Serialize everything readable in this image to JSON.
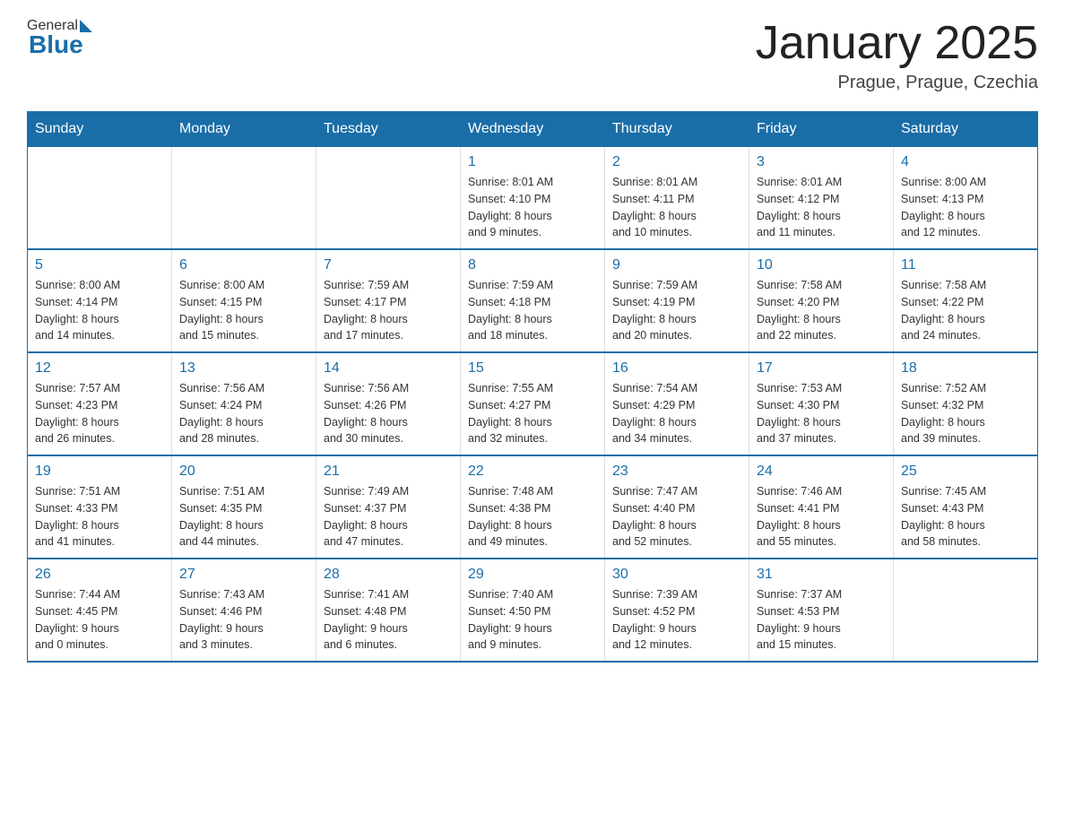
{
  "header": {
    "logo_general": "General",
    "logo_blue": "Blue",
    "title": "January 2025",
    "subtitle": "Prague, Prague, Czechia"
  },
  "days_of_week": [
    "Sunday",
    "Monday",
    "Tuesday",
    "Wednesday",
    "Thursday",
    "Friday",
    "Saturday"
  ],
  "weeks": [
    [
      {
        "day": "",
        "info": ""
      },
      {
        "day": "",
        "info": ""
      },
      {
        "day": "",
        "info": ""
      },
      {
        "day": "1",
        "info": "Sunrise: 8:01 AM\nSunset: 4:10 PM\nDaylight: 8 hours\nand 9 minutes."
      },
      {
        "day": "2",
        "info": "Sunrise: 8:01 AM\nSunset: 4:11 PM\nDaylight: 8 hours\nand 10 minutes."
      },
      {
        "day": "3",
        "info": "Sunrise: 8:01 AM\nSunset: 4:12 PM\nDaylight: 8 hours\nand 11 minutes."
      },
      {
        "day": "4",
        "info": "Sunrise: 8:00 AM\nSunset: 4:13 PM\nDaylight: 8 hours\nand 12 minutes."
      }
    ],
    [
      {
        "day": "5",
        "info": "Sunrise: 8:00 AM\nSunset: 4:14 PM\nDaylight: 8 hours\nand 14 minutes."
      },
      {
        "day": "6",
        "info": "Sunrise: 8:00 AM\nSunset: 4:15 PM\nDaylight: 8 hours\nand 15 minutes."
      },
      {
        "day": "7",
        "info": "Sunrise: 7:59 AM\nSunset: 4:17 PM\nDaylight: 8 hours\nand 17 minutes."
      },
      {
        "day": "8",
        "info": "Sunrise: 7:59 AM\nSunset: 4:18 PM\nDaylight: 8 hours\nand 18 minutes."
      },
      {
        "day": "9",
        "info": "Sunrise: 7:59 AM\nSunset: 4:19 PM\nDaylight: 8 hours\nand 20 minutes."
      },
      {
        "day": "10",
        "info": "Sunrise: 7:58 AM\nSunset: 4:20 PM\nDaylight: 8 hours\nand 22 minutes."
      },
      {
        "day": "11",
        "info": "Sunrise: 7:58 AM\nSunset: 4:22 PM\nDaylight: 8 hours\nand 24 minutes."
      }
    ],
    [
      {
        "day": "12",
        "info": "Sunrise: 7:57 AM\nSunset: 4:23 PM\nDaylight: 8 hours\nand 26 minutes."
      },
      {
        "day": "13",
        "info": "Sunrise: 7:56 AM\nSunset: 4:24 PM\nDaylight: 8 hours\nand 28 minutes."
      },
      {
        "day": "14",
        "info": "Sunrise: 7:56 AM\nSunset: 4:26 PM\nDaylight: 8 hours\nand 30 minutes."
      },
      {
        "day": "15",
        "info": "Sunrise: 7:55 AM\nSunset: 4:27 PM\nDaylight: 8 hours\nand 32 minutes."
      },
      {
        "day": "16",
        "info": "Sunrise: 7:54 AM\nSunset: 4:29 PM\nDaylight: 8 hours\nand 34 minutes."
      },
      {
        "day": "17",
        "info": "Sunrise: 7:53 AM\nSunset: 4:30 PM\nDaylight: 8 hours\nand 37 minutes."
      },
      {
        "day": "18",
        "info": "Sunrise: 7:52 AM\nSunset: 4:32 PM\nDaylight: 8 hours\nand 39 minutes."
      }
    ],
    [
      {
        "day": "19",
        "info": "Sunrise: 7:51 AM\nSunset: 4:33 PM\nDaylight: 8 hours\nand 41 minutes."
      },
      {
        "day": "20",
        "info": "Sunrise: 7:51 AM\nSunset: 4:35 PM\nDaylight: 8 hours\nand 44 minutes."
      },
      {
        "day": "21",
        "info": "Sunrise: 7:49 AM\nSunset: 4:37 PM\nDaylight: 8 hours\nand 47 minutes."
      },
      {
        "day": "22",
        "info": "Sunrise: 7:48 AM\nSunset: 4:38 PM\nDaylight: 8 hours\nand 49 minutes."
      },
      {
        "day": "23",
        "info": "Sunrise: 7:47 AM\nSunset: 4:40 PM\nDaylight: 8 hours\nand 52 minutes."
      },
      {
        "day": "24",
        "info": "Sunrise: 7:46 AM\nSunset: 4:41 PM\nDaylight: 8 hours\nand 55 minutes."
      },
      {
        "day": "25",
        "info": "Sunrise: 7:45 AM\nSunset: 4:43 PM\nDaylight: 8 hours\nand 58 minutes."
      }
    ],
    [
      {
        "day": "26",
        "info": "Sunrise: 7:44 AM\nSunset: 4:45 PM\nDaylight: 9 hours\nand 0 minutes."
      },
      {
        "day": "27",
        "info": "Sunrise: 7:43 AM\nSunset: 4:46 PM\nDaylight: 9 hours\nand 3 minutes."
      },
      {
        "day": "28",
        "info": "Sunrise: 7:41 AM\nSunset: 4:48 PM\nDaylight: 9 hours\nand 6 minutes."
      },
      {
        "day": "29",
        "info": "Sunrise: 7:40 AM\nSunset: 4:50 PM\nDaylight: 9 hours\nand 9 minutes."
      },
      {
        "day": "30",
        "info": "Sunrise: 7:39 AM\nSunset: 4:52 PM\nDaylight: 9 hours\nand 12 minutes."
      },
      {
        "day": "31",
        "info": "Sunrise: 7:37 AM\nSunset: 4:53 PM\nDaylight: 9 hours\nand 15 minutes."
      },
      {
        "day": "",
        "info": ""
      }
    ]
  ]
}
